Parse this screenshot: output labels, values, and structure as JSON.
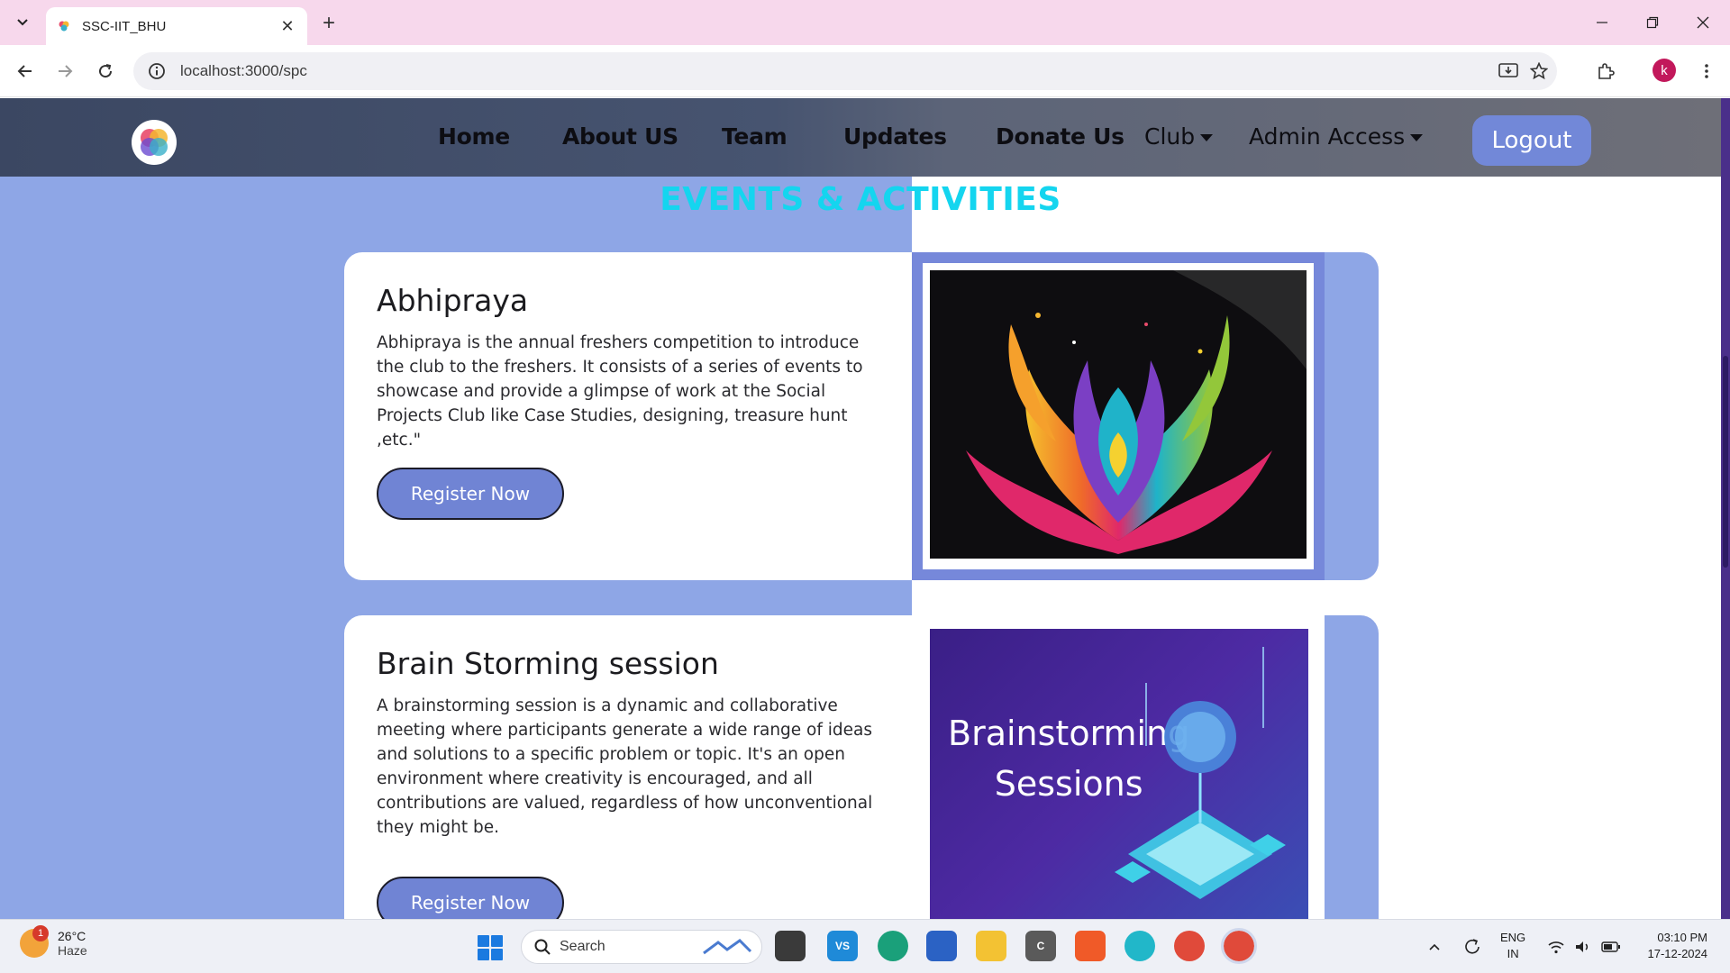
{
  "browser": {
    "tab_title": "SSC-IIT_BHU",
    "url": "localhost:3000/spc",
    "profile_initial": "k"
  },
  "navbar": {
    "links": [
      "Home",
      "About US",
      "Team",
      "Updates",
      "Donate Us"
    ],
    "dropdowns": [
      "Club",
      "Admin Access"
    ],
    "logout_label": "Logout"
  },
  "section_title": "EVENTS & ACTIVITIES",
  "events": [
    {
      "title": "Abhipraya",
      "description": "Abhipraya is the annual freshers competition to introduce the club to the freshers. It consists of a series of events to showcase and provide a glimpse of work at the Social Projects Club like Case Studies, designing, treasure hunt ,etc.\"",
      "button_label": "Register Now"
    },
    {
      "title": "Brain Storming session",
      "description": "A brainstorming session is a dynamic and collaborative meeting where participants generate a wide range of ideas and solutions to a specific problem or topic. It's an open environment where creativity is encouraged, and all contributions are valued, regardless of how unconventional they might be.",
      "button_label": "Register Now",
      "image_text_line1": "Brainstorming",
      "image_text_line2": "Sessions"
    }
  ],
  "taskbar": {
    "weather_temp": "26°C",
    "weather_condition": "Haze",
    "weather_badge": "1",
    "search_label": "Search",
    "lang_line1": "ENG",
    "lang_line2": "IN",
    "time": "03:10 PM",
    "date": "17-12-2024"
  },
  "colors": {
    "page_bg": "#8ea6e6",
    "title_cyan": "#14d5ef",
    "button_bg": "#7084d4",
    "logout_bg": "#7288d8"
  }
}
